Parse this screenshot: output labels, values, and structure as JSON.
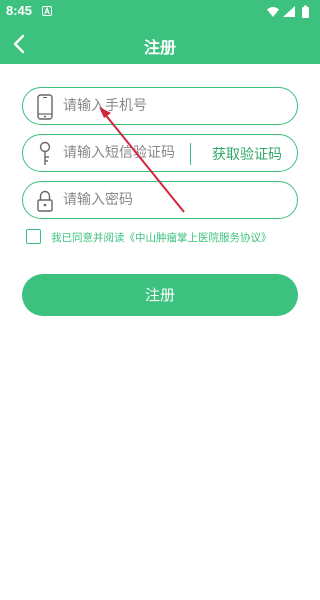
{
  "status_bar": {
    "time": "8:45",
    "notification_icon": "a-letter-icon",
    "icons": [
      "wifi-icon",
      "signal-icon",
      "battery-icon"
    ]
  },
  "header": {
    "title": "注册",
    "back_icon": "chevron-left-icon"
  },
  "form": {
    "phone": {
      "placeholder": "请输入手机号",
      "icon": "phone-icon",
      "value": ""
    },
    "sms_code": {
      "placeholder": "请输入短信验证码",
      "icon": "key-icon",
      "value": "",
      "button_label": "获取验证码"
    },
    "password": {
      "placeholder": "请输入密码",
      "icon": "lock-icon",
      "value": ""
    },
    "agreement": {
      "checked": false,
      "prefix": "我已同意并阅读",
      "link": "《中山肿瘤掌上医院服务协议》"
    },
    "submit_label": "注册"
  },
  "colors": {
    "primary": "#3cc17e",
    "button_text": "#2fa968",
    "annotation_arrow": "#d0263a"
  }
}
